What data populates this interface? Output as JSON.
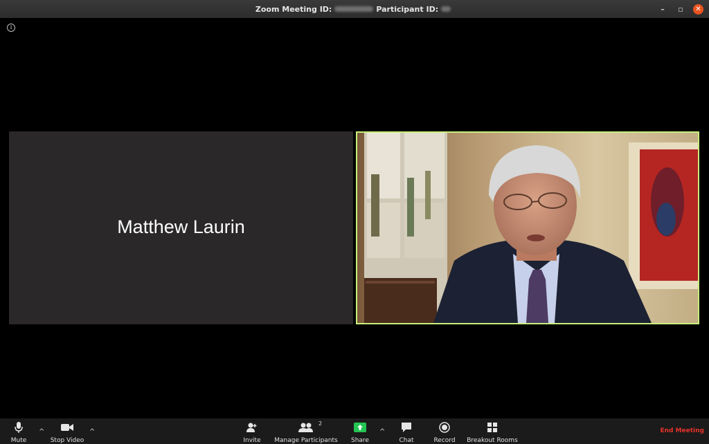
{
  "window": {
    "meeting_label": "Zoom Meeting ID:",
    "participant_label": "Participant ID:",
    "minimize": "–",
    "maximize": "▫",
    "close": "✕"
  },
  "info_glyph": "i",
  "participants": {
    "left_tile_name": "Matthew Laurin"
  },
  "toolbar": {
    "mute_label": "Mute",
    "stop_video_label": "Stop Video",
    "invite_label": "Invite",
    "manage_participants_label": "Manage Participants",
    "participant_count": "2",
    "share_label": "Share",
    "chat_label": "Chat",
    "record_label": "Record",
    "breakout_rooms_label": "Breakout Rooms",
    "end_meeting_label": "End Meeting",
    "caret": "^"
  },
  "colors": {
    "active_speaker_border": "#c9ef7d",
    "share_green": "#23c552",
    "end_meeting_red": "#e8322a"
  }
}
